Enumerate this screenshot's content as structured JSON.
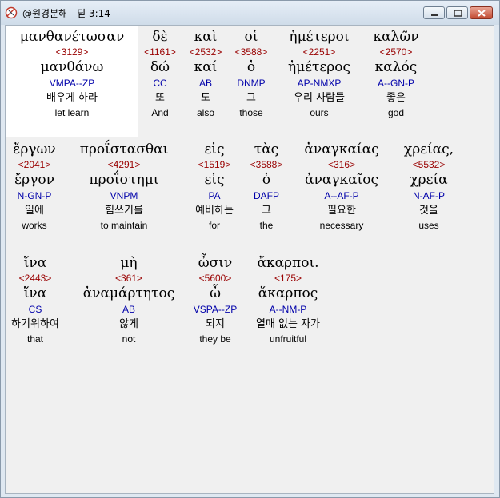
{
  "window": {
    "title": "@원경분해 - 딛 3:14"
  },
  "colors": {
    "strongs": "#990000",
    "parsing": "#0000aa",
    "selected_bg": "#ffffff"
  },
  "words": [
    {
      "greek": "μανθανέτωσαν",
      "strongs": "<3129>",
      "lemma": "μανθάνω",
      "parsing": "VMPA--ZP",
      "korean": "배우게 하라",
      "english": "let learn"
    },
    {
      "greek": "δὲ",
      "strongs": "<1161>",
      "lemma": "δώ",
      "parsing": "CC",
      "korean": "또",
      "english": "And"
    },
    {
      "greek": "καὶ",
      "strongs": "<2532>",
      "lemma": "καί",
      "parsing": "AB",
      "korean": "도",
      "english": "also"
    },
    {
      "greek": "οἱ",
      "strongs": "<3588>",
      "lemma": "ὁ",
      "parsing": "DNMP",
      "korean": "그",
      "english": "those"
    },
    {
      "greek": "ἡμέτεροι",
      "strongs": "<2251>",
      "lemma": "ἡμέτερος",
      "parsing": "AP-NMXP",
      "korean": "우리 사람들",
      "english": "ours"
    },
    {
      "greek": "καλῶν",
      "strongs": "<2570>",
      "lemma": "καλός",
      "parsing": "A--GN-P",
      "korean": "좋은",
      "english": "god"
    },
    {
      "greek": "ἔργων",
      "strongs": "<2041>",
      "lemma": "ἔργον",
      "parsing": "N-GN-P",
      "korean": "일에",
      "english": "works"
    },
    {
      "greek": "προΐστασθαι",
      "strongs": "<4291>",
      "lemma": "προΐστημι",
      "parsing": "VNPM",
      "korean": "힘쓰기를",
      "english": "to maintain"
    },
    {
      "greek": "εἰς",
      "strongs": "<1519>",
      "lemma": "εἰς",
      "parsing": "PA",
      "korean": "예비하는",
      "english": "for"
    },
    {
      "greek": "τὰς",
      "strongs": "<3588>",
      "lemma": "ὁ",
      "parsing": "DAFP",
      "korean": "그",
      "english": "the"
    },
    {
      "greek": "ἀναγκαίας",
      "strongs": "<316>",
      "lemma": "ἀναγκαῖος",
      "parsing": "A--AF-P",
      "korean": "필요한",
      "english": "necessary"
    },
    {
      "greek": "χρείας,",
      "strongs": "<5532>",
      "lemma": "χρεία",
      "parsing": "N-AF-P",
      "korean": "것을",
      "english": "uses"
    },
    {
      "greek": "ἵνα",
      "strongs": "<2443>",
      "lemma": "ἵνα",
      "parsing": "CS",
      "korean": "하기위하여",
      "english": "that"
    },
    {
      "greek": "μὴ",
      "strongs": "<361>",
      "lemma": "ἀναμάρτητος",
      "parsing": "AB",
      "korean": "않게",
      "english": "not"
    },
    {
      "greek": "ὦσιν",
      "strongs": "<5600>",
      "lemma": "ὦ",
      "parsing": "VSPA--ZP",
      "korean": "되지",
      "english": "they be"
    },
    {
      "greek": "ἄκαρποι.",
      "strongs": "<175>",
      "lemma": "ἄκαρπος",
      "parsing": "A--NM-P",
      "korean": "열매 없는 자가",
      "english": "unfruitful"
    }
  ]
}
